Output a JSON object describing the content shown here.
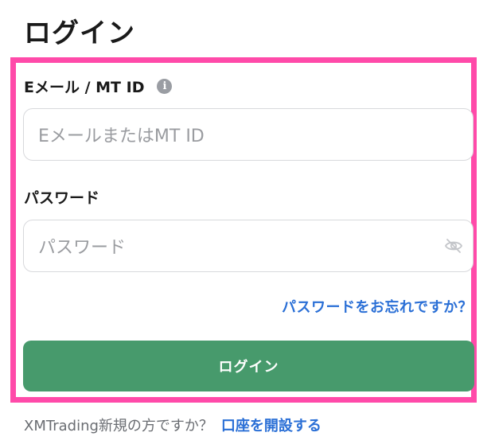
{
  "page": {
    "title": "ログイン"
  },
  "form": {
    "email_label": "Eメール / MT ID",
    "email_info_icon": "i",
    "email_placeholder": "EメールまたはMT ID",
    "password_label": "パスワード",
    "password_placeholder": "パスワード",
    "forgot_password": "パスワードをお忘れですか？",
    "submit_label": "ログイン"
  },
  "footer": {
    "new_user_text": "XMTrading新規の方ですか？",
    "open_account_link": "口座を開設する"
  },
  "colors": {
    "highlight": "#ff4aa9",
    "primary_button": "#479a6c",
    "link": "#2a6fd6"
  }
}
